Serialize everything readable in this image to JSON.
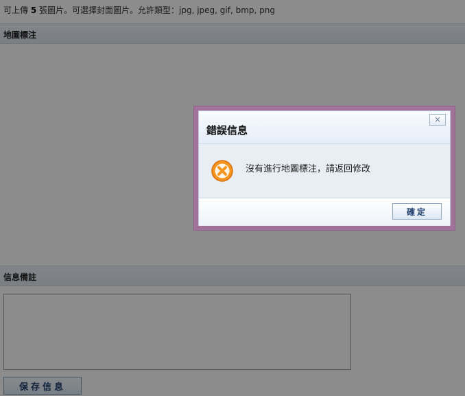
{
  "form": {
    "upload_note_prefix": "可上傳 ",
    "upload_note_count": "5",
    "upload_note_suffix": " 張圖片。可選擇封面圖片。允許類型：jpg, jpeg, gif, bmp, png",
    "map_section_title": "地圖標注",
    "info_section_title": "信息備註",
    "remark_value": "",
    "save_label": "保存信息"
  },
  "dialog": {
    "title": "錯誤信息",
    "close_label": "×",
    "message": "沒有進行地圖標注，請返回修改",
    "ok_label": "確定",
    "icon": "error-icon",
    "frame_color": "#a0729a",
    "icon_color": "#f7941d"
  },
  "overlay": {
    "color": "#000000",
    "opacity": 0.45
  }
}
